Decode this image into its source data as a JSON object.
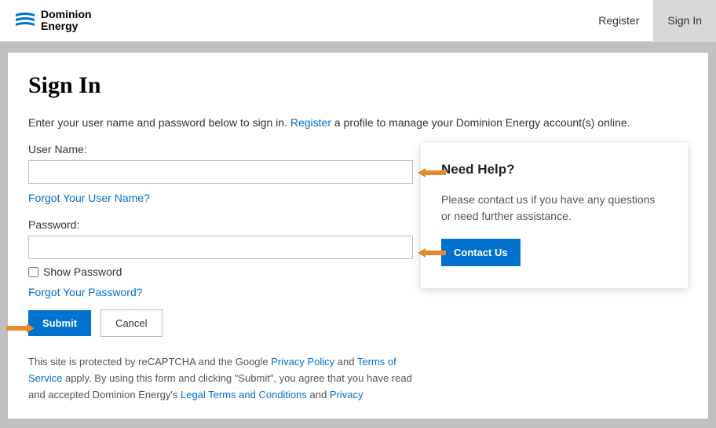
{
  "header": {
    "brand_line1": "Dominion",
    "brand_line2": "Energy",
    "nav_register": "Register",
    "nav_signin": "Sign In"
  },
  "page": {
    "title": "Sign In",
    "intro_prefix": "Enter your user name and password below to sign in. ",
    "intro_register": "Register",
    "intro_suffix": " a profile to manage your Dominion Energy account(s) online.",
    "username_label": "User Name:",
    "forgot_username": "Forgot Your User Name?",
    "password_label": "Password:",
    "show_password": "Show Password",
    "forgot_password": "Forgot Your Password?",
    "submit": "Submit",
    "cancel": "Cancel"
  },
  "footer": {
    "t1": "This site is protected by reCAPTCHA and the Google ",
    "privacy_policy": "Privacy Policy",
    "t2": " and ",
    "tos": "Terms of Service",
    "t3": " apply. By using this form and clicking \"Submit\", you agree that you have read and accepted Dominion Energy's ",
    "legal": "Legal Terms and Conditions",
    "t4": " and ",
    "privacy": "Privacy"
  },
  "help": {
    "title": "Need Help?",
    "body": "Please contact us if you have any questions or need further assistance.",
    "button": "Contact Us"
  }
}
